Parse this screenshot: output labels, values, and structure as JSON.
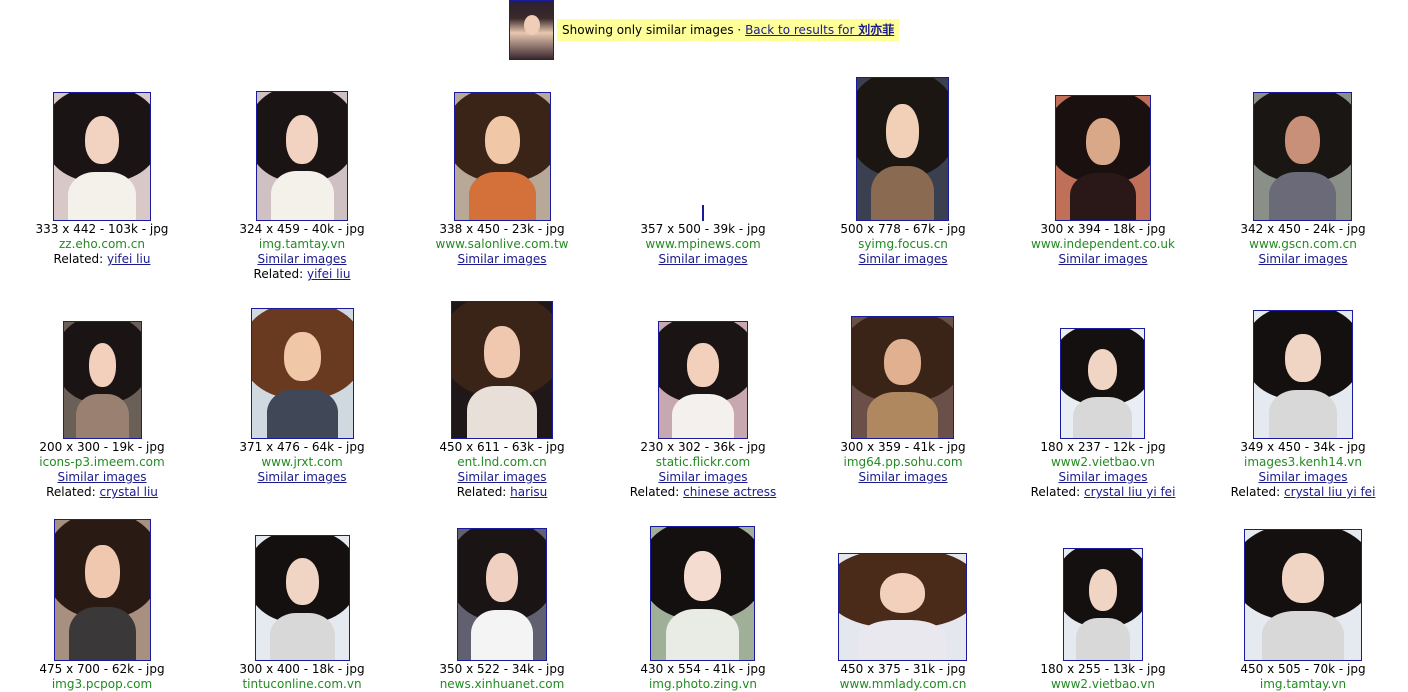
{
  "header": {
    "showing_text": "Showing only similar images · ",
    "back_text": "Back to results for ",
    "query": "刘亦菲"
  },
  "labels": {
    "similar": "Similar images",
    "related_prefix": "Related: "
  },
  "results": [
    {
      "meta": "333 x 442 - 103k - jpg",
      "domain": "zz.eho.com.cn",
      "similar": false,
      "related": "yifei liu",
      "bg": "#d8c8c8",
      "hair": "#1a1414",
      "skin": "#f2d2c0",
      "cloth": "#f4f0ea"
    },
    {
      "meta": "324 x 459 - 40k - jpg",
      "domain": "img.tamtay.vn",
      "similar": true,
      "related": "yifei liu",
      "bg": "#cfc0c4",
      "hair": "#1a1414",
      "skin": "#f2d2c0",
      "cloth": "#f4f0ea"
    },
    {
      "meta": "338 x 450 - 23k - jpg",
      "domain": "www.salonlive.com.tw",
      "similar": true,
      "related": "",
      "bg": "#b8a898",
      "hair": "#3a2418",
      "skin": "#f0c8a8",
      "cloth": "#d4703a"
    },
    {
      "meta": "357 x 500 - 39k - jpg",
      "domain": "www.mpinews.com",
      "similar": true,
      "related": "",
      "bg": "#ffffff",
      "hair": "#ffffff",
      "skin": "#ffffff",
      "cloth": "#ffffff"
    },
    {
      "meta": "500 x 778 - 67k - jpg",
      "domain": "syimg.focus.cn",
      "similar": true,
      "related": "",
      "bg": "#3a4050",
      "hair": "#1c1612",
      "skin": "#f2d0b8",
      "cloth": "#8a6a50"
    },
    {
      "meta": "300 x 394 - 18k - jpg",
      "domain": "www.independent.co.uk",
      "similar": true,
      "related": "",
      "bg": "#c07058",
      "hair": "#1a1010",
      "skin": "#d8a888",
      "cloth": "#2a1818"
    },
    {
      "meta": "342 x 450 - 24k - jpg",
      "domain": "www.gscn.com.cn",
      "similar": true,
      "related": "",
      "bg": "#8a9088",
      "hair": "#1a1614",
      "skin": "#c89078",
      "cloth": "#6a6a78"
    },
    {
      "meta": "200 x 300 - 19k - jpg",
      "domain": "icons-p3.imeem.com",
      "similar": true,
      "related": "crystal liu",
      "bg": "#6a6058",
      "hair": "#1a1414",
      "skin": "#f2d0bc",
      "cloth": "#9a8070"
    },
    {
      "meta": "371 x 476 - 64k - jpg",
      "domain": "www.jrxt.com",
      "similar": true,
      "related": "",
      "bg": "#d0d8e0",
      "hair": "#6a3a20",
      "skin": "#f0c8a8",
      "cloth": "#404858"
    },
    {
      "meta": "450 x 611 - 63k - jpg",
      "domain": "ent.lnd.com.cn",
      "similar": true,
      "related": "harisu",
      "bg": "#201818",
      "hair": "#3a2418",
      "skin": "#f0c8b0",
      "cloth": "#e8e0d8"
    },
    {
      "meta": "230 x 302 - 36k - jpg",
      "domain": "static.flickr.com",
      "similar": true,
      "related": "chinese actress",
      "bg": "#c8a8b0",
      "hair": "#1a1414",
      "skin": "#f2d0bc",
      "cloth": "#f4f0ee"
    },
    {
      "meta": "300 x 359 - 41k - jpg",
      "domain": "img64.pp.sohu.com",
      "similar": true,
      "related": "",
      "bg": "#6a5048",
      "hair": "#3a2418",
      "skin": "#e0b090",
      "cloth": "#b08860"
    },
    {
      "meta": "180 x 237 - 12k - jpg",
      "domain": "www2.vietbao.vn",
      "similar": true,
      "related": "crystal liu yi fei",
      "bg": "#e8eef4",
      "hair": "#141010",
      "skin": "#f0d4c4",
      "cloth": "#d8d8d8"
    },
    {
      "meta": "349 x 450 - 34k - jpg",
      "domain": "images3.kenh14.vn",
      "similar": true,
      "related": "crystal liu yi fei",
      "bg": "#e4eaf0",
      "hair": "#141010",
      "skin": "#f0d4c4",
      "cloth": "#d8d8d8"
    },
    {
      "meta": "475 x 700 - 62k - jpg",
      "domain": "img3.pcpop.com",
      "similar": false,
      "related": "",
      "bg": "#a89080",
      "hair": "#2a1a14",
      "skin": "#f0c8b0",
      "cloth": "#3a3838"
    },
    {
      "meta": "300 x 400 - 18k - jpg",
      "domain": "tintuconline.com.vn",
      "similar": false,
      "related": "",
      "bg": "#e4eaf0",
      "hair": "#141010",
      "skin": "#f0d4c4",
      "cloth": "#d8d8d8"
    },
    {
      "meta": "350 x 522 - 34k - jpg",
      "domain": "news.xinhuanet.com",
      "similar": false,
      "related": "",
      "bg": "#606070",
      "hair": "#1a1414",
      "skin": "#f0d0c0",
      "cloth": "#f4f4f4"
    },
    {
      "meta": "430 x 554 - 41k - jpg",
      "domain": "img.photo.zing.vn",
      "similar": false,
      "related": "",
      "bg": "#a0b098",
      "hair": "#141010",
      "skin": "#f4dcd0",
      "cloth": "#e8ece4"
    },
    {
      "meta": "450 x 375 - 31k - jpg",
      "domain": "www.mmlady.com.cn",
      "similar": false,
      "related": "",
      "bg": "#e4e8ee",
      "hair": "#4a2a18",
      "skin": "#f2d0bc",
      "cloth": "#e8e8ee"
    },
    {
      "meta": "180 x 255 - 13k - jpg",
      "domain": "www2.vietbao.vn",
      "similar": false,
      "related": "",
      "bg": "#e4eaf0",
      "hair": "#141010",
      "skin": "#f0d4c4",
      "cloth": "#d8d8d8"
    },
    {
      "meta": "450 x 505 - 70k - jpg",
      "domain": "img.tamtay.vn",
      "similar": false,
      "related": "",
      "bg": "#e4eaf0",
      "hair": "#141010",
      "skin": "#f0d4c4",
      "cloth": "#d8d8d8"
    }
  ]
}
